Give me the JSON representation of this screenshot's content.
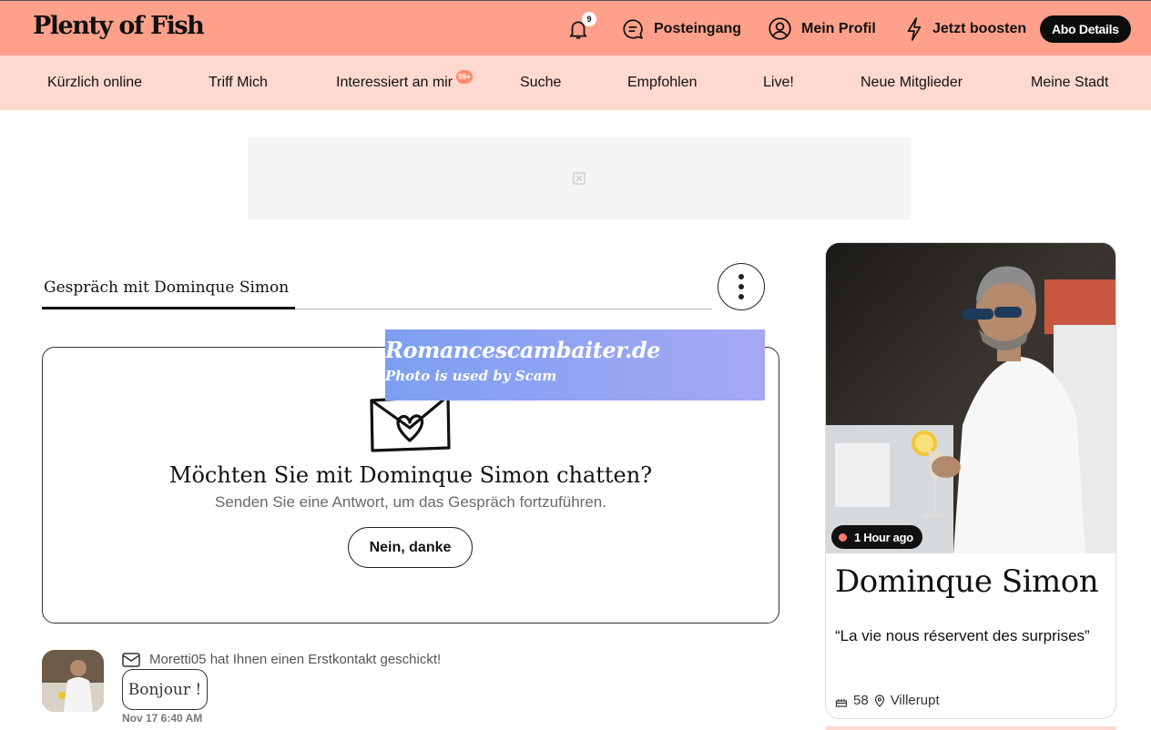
{
  "header": {
    "logo": "Plenty of Fish",
    "notifications_count": "9",
    "inbox_label": "Posteingang",
    "profile_label": "Mein Profil",
    "boost_label": "Jetzt boosten",
    "abo_label": "Abo Details"
  },
  "subnav": {
    "items": [
      {
        "label": "Kürzlich online"
      },
      {
        "label": "Triff Mich"
      },
      {
        "label": "Interessiert an mir",
        "badge": "99+"
      },
      {
        "label": "Suche"
      },
      {
        "label": "Empfohlen"
      },
      {
        "label": "Live!"
      },
      {
        "label": "Neue Mitglieder"
      },
      {
        "label": "Meine Stadt"
      }
    ]
  },
  "conversation": {
    "title": "Gespräch mit Dominque Simon"
  },
  "prompt": {
    "heading": "Möchten Sie mit Dominque Simon chatten?",
    "subtext": "Senden Sie eine Antwort, um das Gespräch fortzuführen.",
    "decline_label": "Nein, danke"
  },
  "watermark": {
    "line1": "Romancescambaiter.de",
    "line2": "Photo is used by Scam"
  },
  "message": {
    "header": "Moretti05 hat Ihnen einen Erstkontakt geschickt!",
    "text": "Bonjour !",
    "time": "Nov 17 6:40 AM"
  },
  "profile_card": {
    "status": "1 Hour ago",
    "name": "Dominque Simon",
    "quote": "“La vie nous réservent des surprises”",
    "age": "58",
    "city": "Villerupt"
  },
  "colors": {
    "header_bg": "#ffa18a",
    "subnav_bg": "#ffd9cf",
    "accent_dot": "#ff7a6a"
  }
}
